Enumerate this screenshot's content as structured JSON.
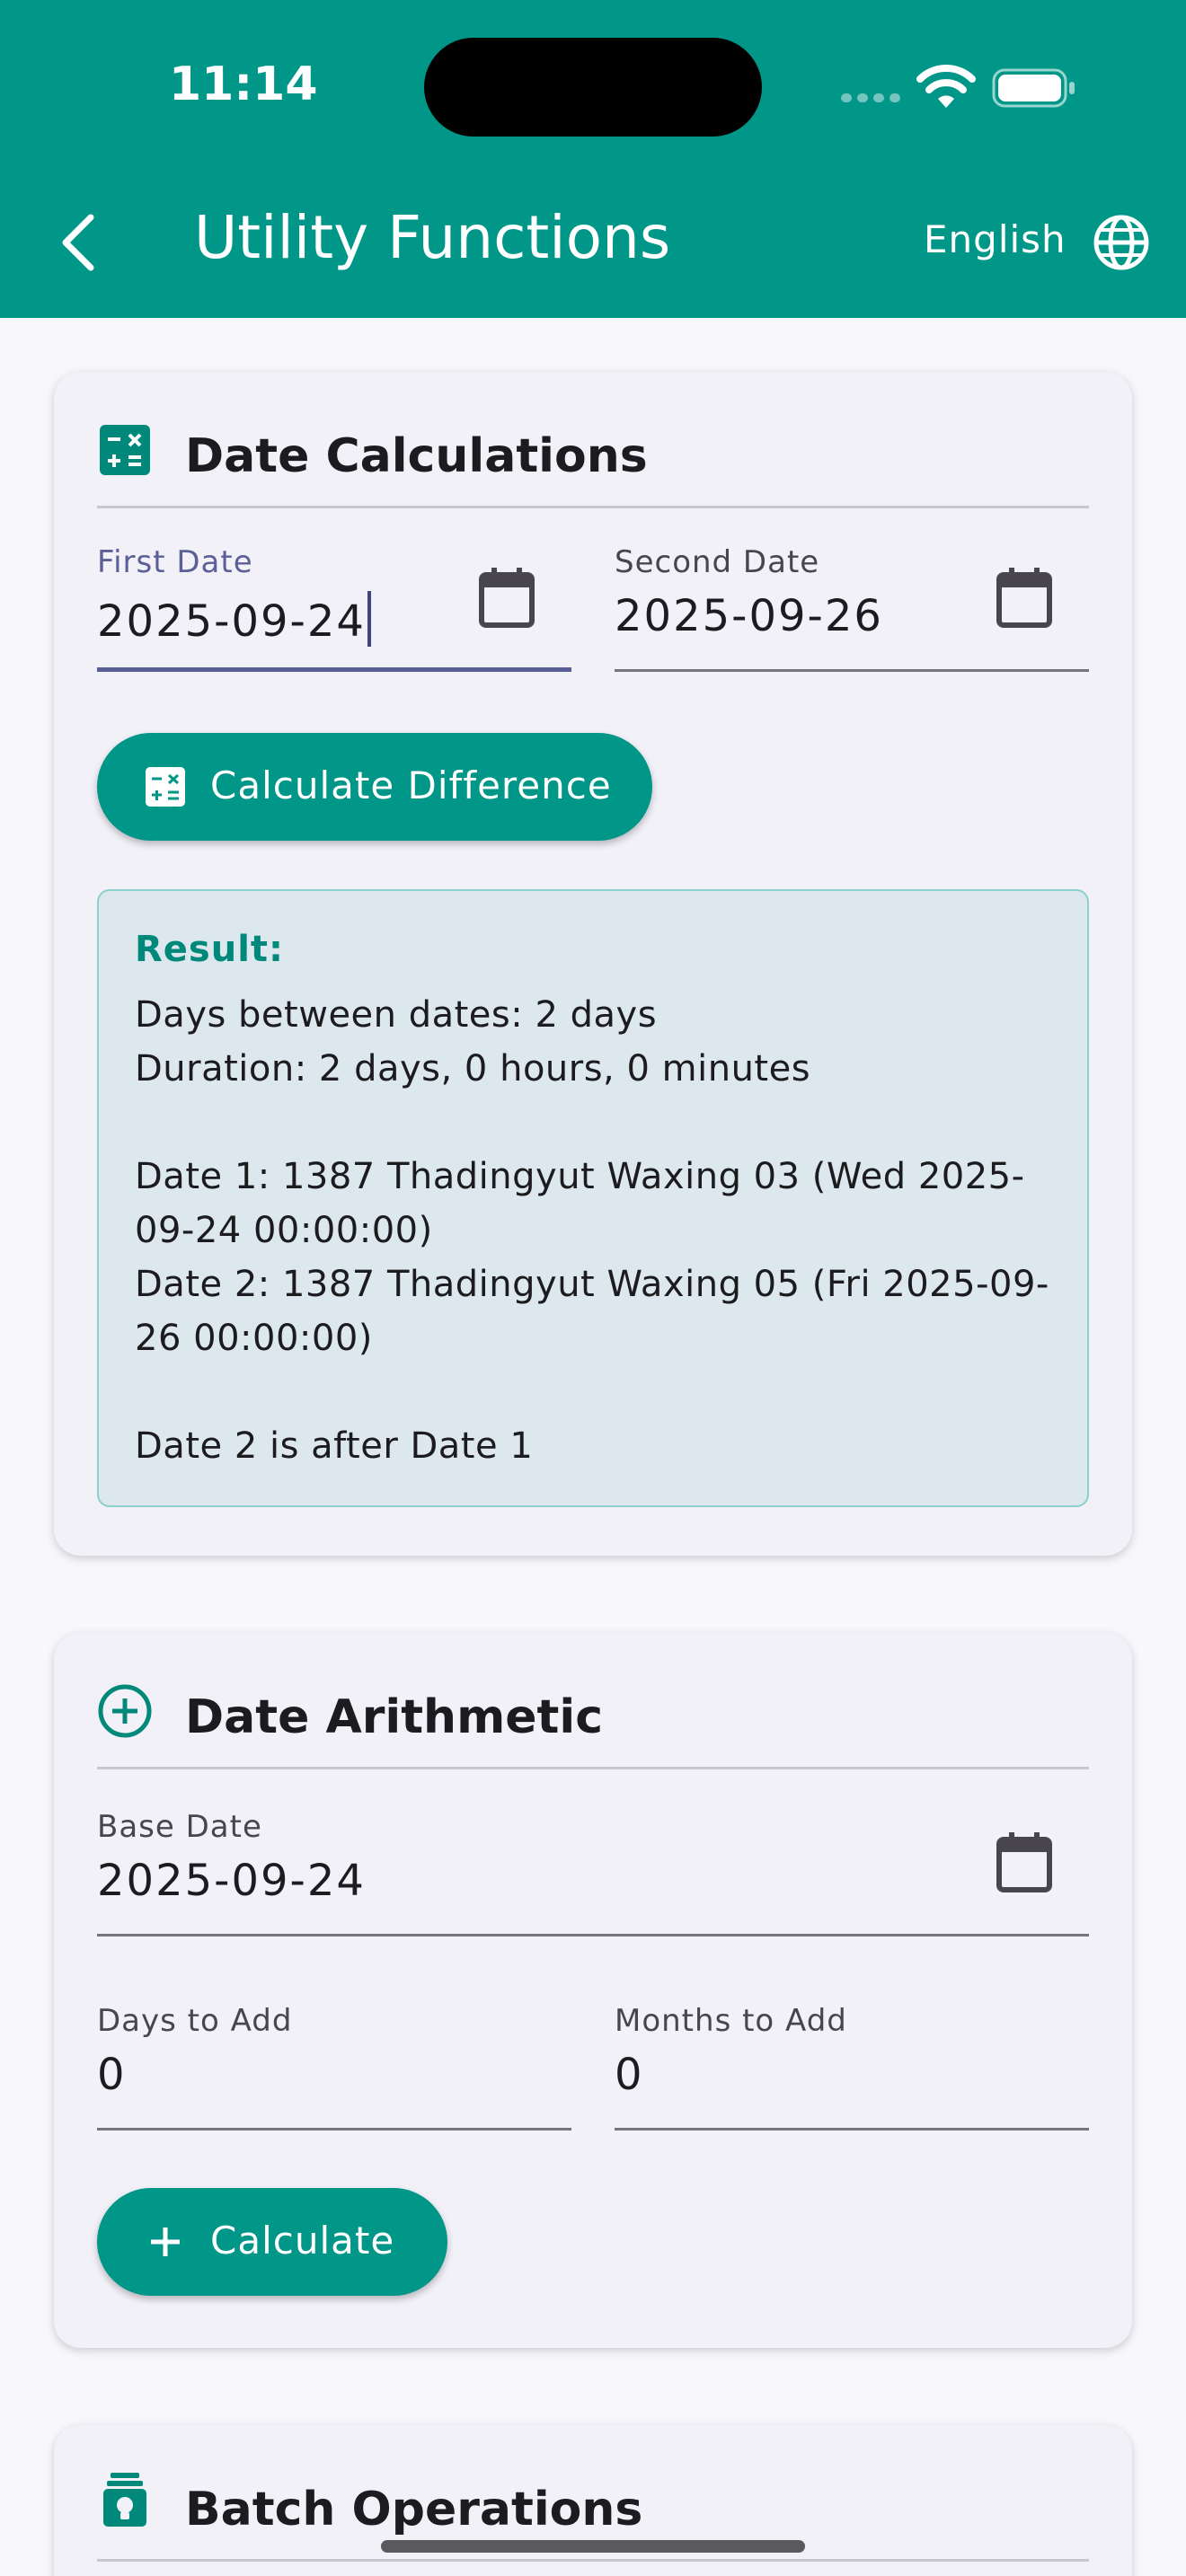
{
  "status_bar": {
    "time": "11:14"
  },
  "app_bar": {
    "title": "Utility Functions",
    "language": "English"
  },
  "date_calculations": {
    "title": "Date Calculations",
    "first_date": {
      "label": "First Date",
      "value": "2025-09-24"
    },
    "second_date": {
      "label": "Second Date",
      "value": "2025-09-26"
    },
    "button_label": "Calculate Difference",
    "result": {
      "title": "Result:",
      "text": "Days between dates: 2 days\nDuration: 2 days, 0 hours, 0 minutes\n\nDate 1: 1387 Thadingyut Waxing 03 (Wed 2025-09-24 00:00:00)\nDate 2: 1387 Thadingyut Waxing 05 (Fri 2025-09-26 00:00:00)\n\nDate 2 is after Date 1"
    }
  },
  "date_arithmetic": {
    "title": "Date Arithmetic",
    "base_date": {
      "label": "Base Date",
      "value": "2025-09-24"
    },
    "days_to_add": {
      "label": "Days to Add",
      "value": "0"
    },
    "months_to_add": {
      "label": "Months to Add",
      "value": "0"
    },
    "button_label": "Calculate"
  },
  "batch_operations": {
    "title": "Batch Operations"
  },
  "colors": {
    "primary": "#009688",
    "card": "#F3F1F8",
    "focus": "#5A5F98",
    "result_bg": "#DCE8EE"
  }
}
